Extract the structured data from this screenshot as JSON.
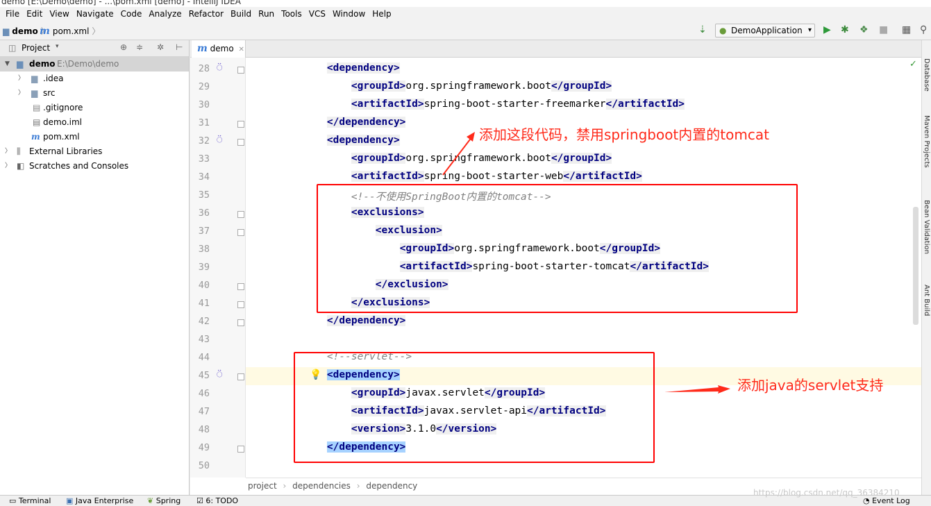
{
  "window": {
    "title": "demo [E:\\Demo\\demo] - ...\\pom.xml [demo] - IntelliJ IDEA"
  },
  "menu": [
    "File",
    "Edit",
    "View",
    "Navigate",
    "Code",
    "Analyze",
    "Refactor",
    "Build",
    "Run",
    "Tools",
    "VCS",
    "Window",
    "Help"
  ],
  "nav": {
    "project": "demo",
    "file": "pom.xml"
  },
  "run_config": {
    "label": "DemoApplication"
  },
  "project_panel": {
    "title": "Project",
    "tree": [
      {
        "label": "demo",
        "path": "E:\\Demo\\demo",
        "kind": "module"
      },
      {
        "label": ".idea",
        "kind": "folder"
      },
      {
        "label": "src",
        "kind": "folder"
      },
      {
        "label": ".gitignore",
        "kind": "file"
      },
      {
        "label": "demo.iml",
        "kind": "file"
      },
      {
        "label": "pom.xml",
        "kind": "maven"
      },
      {
        "label": "External Libraries",
        "kind": "libs"
      },
      {
        "label": "Scratches and Consoles",
        "kind": "scratch"
      }
    ]
  },
  "editor": {
    "tab": "demo",
    "lines": [
      {
        "n": "28",
        "p": [
          [
            "    ",
            ""
          ],
          [
            "<dependency>",
            "tag"
          ]
        ]
      },
      {
        "n": "29",
        "p": [
          [
            "        ",
            ""
          ],
          [
            "<groupId>",
            "tag"
          ],
          [
            "org.springframework.boot",
            ""
          ],
          [
            "</groupId>",
            "tag"
          ]
        ]
      },
      {
        "n": "30",
        "p": [
          [
            "        ",
            ""
          ],
          [
            "<artifactId>",
            "tag"
          ],
          [
            "spring-boot-starter-freemarker",
            ""
          ],
          [
            "</artifactId>",
            "tag"
          ]
        ]
      },
      {
        "n": "31",
        "p": [
          [
            "    ",
            ""
          ],
          [
            "</dependency>",
            "tag"
          ]
        ]
      },
      {
        "n": "32",
        "p": [
          [
            "    ",
            ""
          ],
          [
            "<dependency>",
            "tag"
          ]
        ]
      },
      {
        "n": "33",
        "p": [
          [
            "        ",
            ""
          ],
          [
            "<groupId>",
            "tag"
          ],
          [
            "org.springframework.boot",
            ""
          ],
          [
            "</groupId>",
            "tag"
          ]
        ]
      },
      {
        "n": "34",
        "p": [
          [
            "        ",
            ""
          ],
          [
            "<artifactId>",
            "tag"
          ],
          [
            "spring-boot-starter-web",
            ""
          ],
          [
            "</artifactId>",
            "tag"
          ]
        ]
      },
      {
        "n": "35",
        "p": [
          [
            "        ",
            ""
          ],
          [
            "<!--不使用SpringBoot内置的tomcat-->",
            "cmt"
          ]
        ]
      },
      {
        "n": "36",
        "p": [
          [
            "        ",
            ""
          ],
          [
            "<exclusions>",
            "tag"
          ]
        ]
      },
      {
        "n": "37",
        "p": [
          [
            "            ",
            ""
          ],
          [
            "<exclusion>",
            "tag"
          ]
        ]
      },
      {
        "n": "38",
        "p": [
          [
            "                ",
            ""
          ],
          [
            "<groupId>",
            "tag"
          ],
          [
            "org.springframework.boot",
            ""
          ],
          [
            "</groupId>",
            "tag"
          ]
        ]
      },
      {
        "n": "39",
        "p": [
          [
            "                ",
            ""
          ],
          [
            "<artifactId>",
            "tag"
          ],
          [
            "spring-boot-starter-tomcat",
            ""
          ],
          [
            "</artifactId>",
            "tag"
          ]
        ]
      },
      {
        "n": "40",
        "p": [
          [
            "            ",
            ""
          ],
          [
            "</exclusion>",
            "tag"
          ]
        ]
      },
      {
        "n": "41",
        "p": [
          [
            "        ",
            ""
          ],
          [
            "</exclusions>",
            "tag"
          ]
        ]
      },
      {
        "n": "42",
        "p": [
          [
            "    ",
            ""
          ],
          [
            "</dependency>",
            "tag"
          ]
        ]
      },
      {
        "n": "43",
        "p": []
      },
      {
        "n": "44",
        "p": [
          [
            "    ",
            ""
          ],
          [
            "<!--servlet-->",
            "cmt"
          ]
        ]
      },
      {
        "n": "45",
        "p": [
          [
            "    ",
            ""
          ],
          [
            "<dependency>",
            "tag hl"
          ]
        ]
      },
      {
        "n": "46",
        "p": [
          [
            "        ",
            ""
          ],
          [
            "<groupId>",
            "tag"
          ],
          [
            "javax.servlet",
            ""
          ],
          [
            "</groupId>",
            "tag"
          ]
        ]
      },
      {
        "n": "47",
        "p": [
          [
            "        ",
            ""
          ],
          [
            "<artifactId>",
            "tag"
          ],
          [
            "javax.servlet-api",
            ""
          ],
          [
            "</artifactId>",
            "tag"
          ]
        ]
      },
      {
        "n": "48",
        "p": [
          [
            "        ",
            ""
          ],
          [
            "<version>",
            "tag"
          ],
          [
            "3.1.0",
            ""
          ],
          [
            "</version>",
            "tag"
          ]
        ]
      },
      {
        "n": "49",
        "p": [
          [
            "    ",
            ""
          ],
          [
            "</dependency>",
            "tag hl"
          ]
        ]
      },
      {
        "n": "50",
        "p": []
      }
    ],
    "breadcrumb": [
      "project",
      "dependencies",
      "dependency"
    ]
  },
  "right_tools": [
    "Database",
    "Maven Projects",
    "Bean Validation",
    "Ant Build"
  ],
  "status": {
    "terminal": "Terminal",
    "java_ee": "Java Enterprise",
    "spring": "Spring",
    "todo": "6: TODO",
    "event_log": "Event Log"
  },
  "annotations": {
    "exclusion_note": "添加这段代码，禁用springboot内置的tomcat",
    "servlet_note": "添加java的servlet支持"
  },
  "watermark": "https://blog.csdn.net/qq_36384210",
  "colors": {
    "tag": "#000080",
    "comment": "#808080",
    "annotation": "#ff2a1a",
    "selection": "#a6d2ff"
  }
}
